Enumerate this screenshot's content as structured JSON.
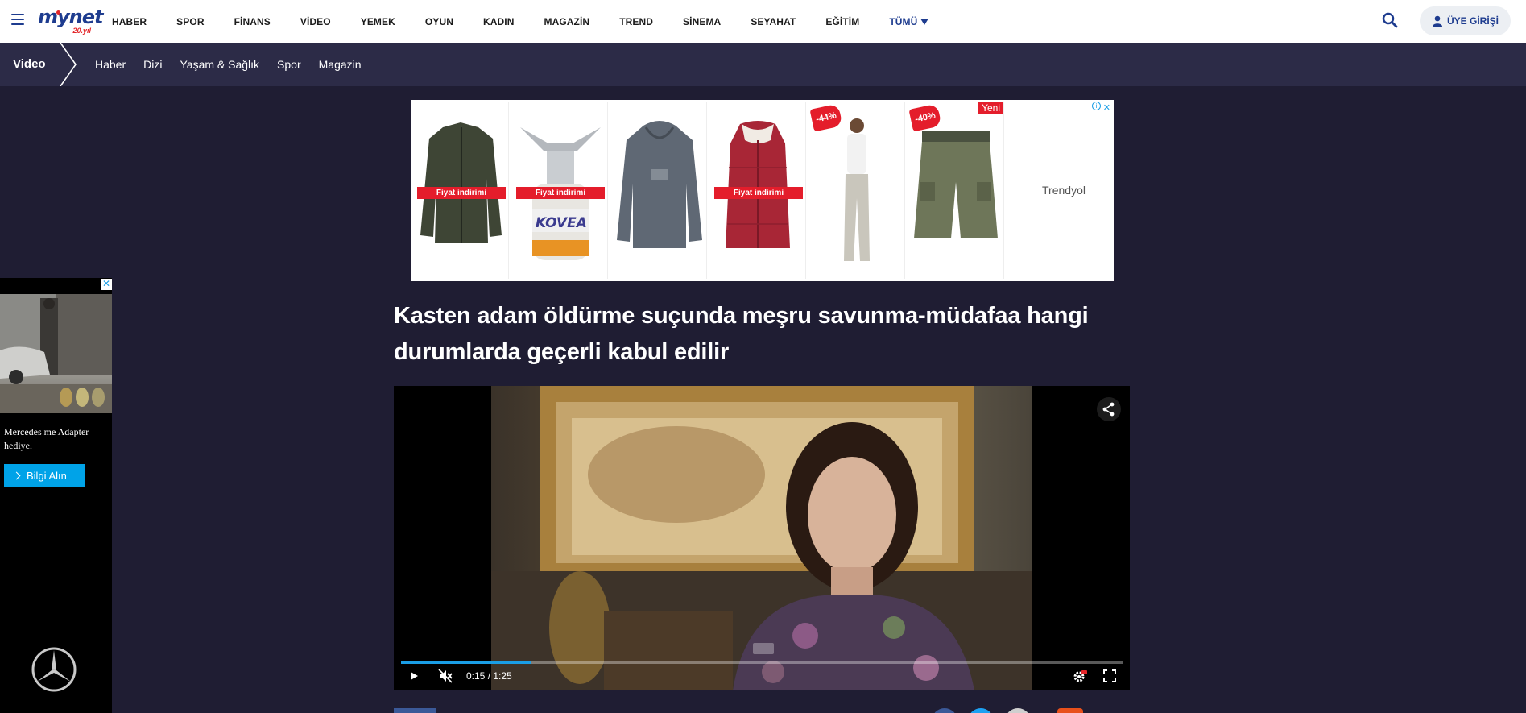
{
  "header": {
    "logo": {
      "text": "mynet",
      "sub": "20.yıl"
    },
    "nav": [
      "HABER",
      "SPOR",
      "FİNANS",
      "VİDEO",
      "YEMEK",
      "OYUN",
      "KADIN",
      "MAGAZİN",
      "TREND",
      "SİNEMA",
      "SEYAHAT",
      "EĞİTİM"
    ],
    "more_label": "TÜMÜ",
    "login_label": "ÜYE GİRİŞİ",
    "accent": "#1e3c8f"
  },
  "subnav": {
    "section": "Video",
    "items": [
      "Haber",
      "Dizi",
      "Yaşam & Sağlık",
      "Spor",
      "Magazin"
    ]
  },
  "ad": {
    "products": [
      {
        "icon": "jacket",
        "banner": "Fiyat indirimi"
      },
      {
        "icon": "gas-stove",
        "banner": "Fiyat indirimi"
      },
      {
        "icon": "hoodie",
        "banner": ""
      },
      {
        "icon": "vest",
        "banner": "Fiyat indirimi"
      },
      {
        "icon": "tracksuit",
        "discount": "-44%"
      },
      {
        "icon": "shorts",
        "discount": "-40%",
        "tag": "Yeni"
      }
    ],
    "brand": "Trendyol"
  },
  "side_ad": {
    "text": "Mercedes me Adapter hediye.",
    "cta": "Bilgi Alın"
  },
  "article": {
    "title": "Kasten adam öldürme suçunda meşru savunma-müdafaa hangi durumlarda geçerli kabul edilir"
  },
  "video": {
    "time": "0:15 / 1:25",
    "progress": 0.18,
    "accent": "#1a9ee6"
  }
}
